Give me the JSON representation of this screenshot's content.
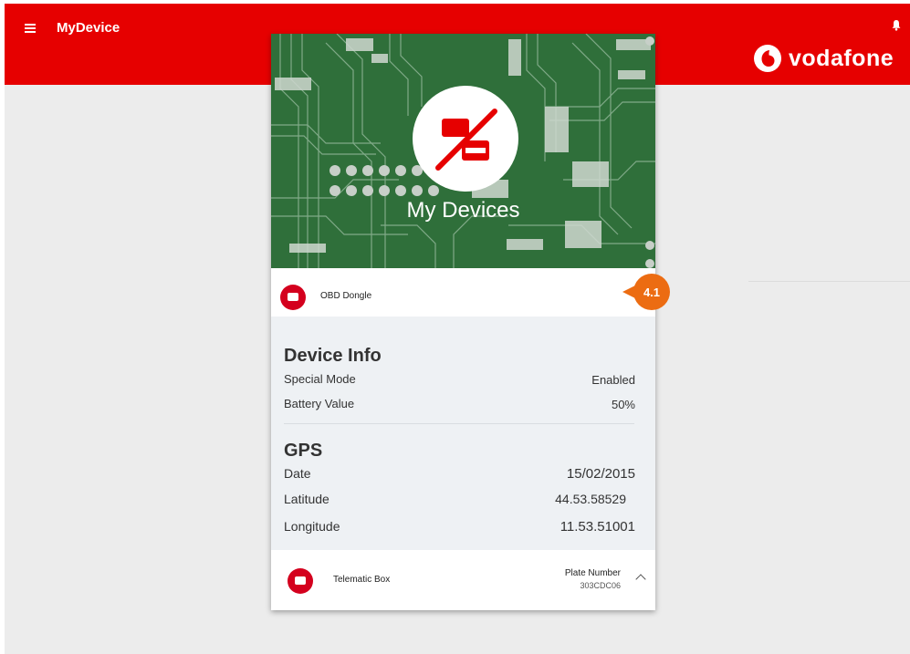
{
  "app": {
    "title": "MyDevice"
  },
  "header": {
    "brand_name": "vodafone",
    "menu_icon": "hamburger-menu-icon",
    "bell_icon": "notification-bell-icon"
  },
  "hero": {
    "title": "My Devices",
    "icon": "no-device-icon"
  },
  "devices": [
    {
      "name": "OBD Dongle",
      "icon": "device-icon"
    },
    {
      "name": "Telematic Box",
      "icon": "device-icon",
      "plate_label": "Plate Number",
      "plate_value": "303CDC06"
    }
  ],
  "device_info": {
    "title": "Device Info",
    "rows": [
      {
        "label": "Special Mode",
        "value": "Enabled"
      },
      {
        "label": "Battery Value",
        "value": "50%"
      }
    ]
  },
  "gps": {
    "title": "GPS",
    "rows": [
      {
        "label": "Date",
        "value": "15/02/2015"
      },
      {
        "label": "Latitude",
        "value": "44.53.58529"
      },
      {
        "label": "Longitude",
        "value": "11.53.51001"
      }
    ]
  },
  "callout": {
    "label": "4.1"
  },
  "colors": {
    "brand_red": "#e60000",
    "device_red": "#d4001e",
    "callout_orange": "#ec6c12",
    "pcb_green": "#2f6f3a"
  }
}
